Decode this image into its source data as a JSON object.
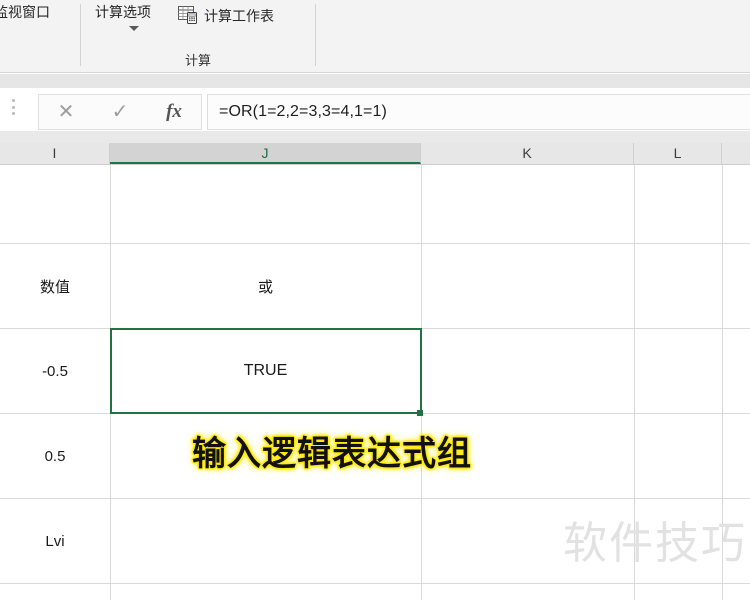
{
  "ribbon": {
    "watch_window_label": "监视窗口",
    "calc_options_label": "计算选项",
    "calc_sheet_label": "计算工作表",
    "calc_sheet_icon": "calculate-sheet-icon",
    "group_label_calc": "计算",
    "caret_icon": "chevron-down-icon"
  },
  "formula_bar": {
    "cancel_icon": "cancel-icon",
    "cancel_glyph": "✕",
    "confirm_icon": "confirm-check-icon",
    "confirm_glyph": "✓",
    "fx_label": "fx",
    "formula_value": "=OR(1=2,2=3,3=4,1=1)",
    "formula_placeholder": ""
  },
  "grid": {
    "columns": [
      {
        "label": "I",
        "selected": false
      },
      {
        "label": "J",
        "selected": true
      },
      {
        "label": "K",
        "selected": false
      },
      {
        "label": "L",
        "selected": false
      }
    ],
    "cells": {
      "i_header": "数值",
      "j_header": "或",
      "i_row2": "-0.5",
      "j_row2": "TRUE",
      "i_row3": "0.5",
      "i_row4": "Lvi"
    },
    "selected_cell_value": "TRUE",
    "selection_color": "#217346"
  },
  "annotation": {
    "text": "输入逻辑表达式组",
    "text_color": "#111111",
    "glow_color": "#ffe800"
  },
  "watermark": {
    "text": "软件技巧",
    "color": "#e2e2e2"
  }
}
